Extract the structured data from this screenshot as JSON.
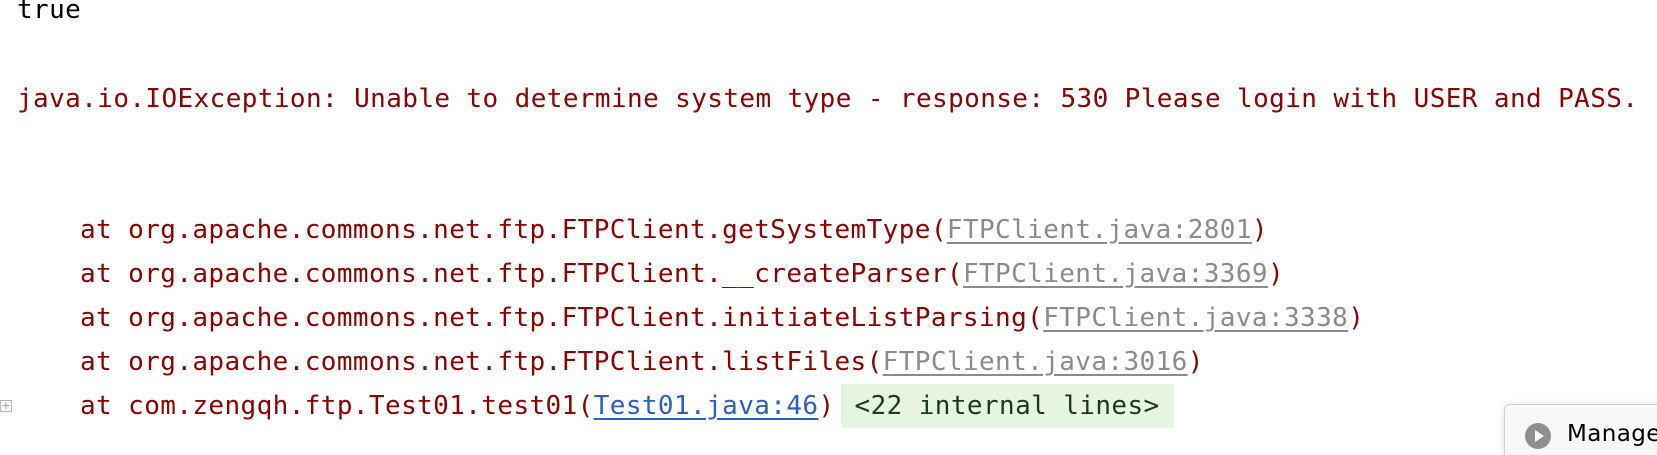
{
  "console": {
    "stdout_line": "true",
    "exception_line": "java.io.IOException: Unable to determine system type - response: 530 Please login with USER and PASS.",
    "frames": [
      {
        "prefix": "at org.apache.commons.net.ftp.FTPClient.getSystemType(",
        "link": "FTPClient.java:2801",
        "suffix": ")"
      },
      {
        "prefix": "at org.apache.commons.net.ftp.FTPClient.__createParser(",
        "link": "FTPClient.java:3369",
        "suffix": ")"
      },
      {
        "prefix": "at org.apache.commons.net.ftp.FTPClient.initiateListParsing(",
        "link": "FTPClient.java:3338",
        "suffix": ")"
      },
      {
        "prefix": "at org.apache.commons.net.ftp.FTPClient.listFiles(",
        "link": "FTPClient.java:3016",
        "suffix": ")"
      },
      {
        "prefix": "at com.zengqh.ftp.Test01.test01(",
        "link": "Test01.java:46",
        "suffix": ")",
        "internal": "<22 internal lines>"
      }
    ],
    "fold_icon": "+"
  },
  "popup": {
    "icon": "play-circle-icon",
    "label": "Manage"
  },
  "colors": {
    "error": "#8b0000",
    "library_link": "#8c8c8c",
    "project_link": "#2a5fc4",
    "internal_bg": "#e6f4e2"
  }
}
